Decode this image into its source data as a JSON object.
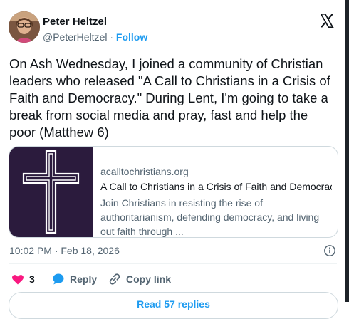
{
  "author": {
    "name": "Peter Heltzel",
    "handle": "@PeterHeltzel",
    "separator": "·",
    "follow_label": "Follow"
  },
  "tweet": {
    "text": "On Ash Wednesday, I joined a community of Christian leaders who released \"A Call to Christians in a Crisis of Faith and Democracy.\" During Lent, I'm going to take a break from social media and pray, fast and help the poor (Matthew 6)"
  },
  "card": {
    "domain": "acalltochristians.org",
    "title": "A Call to Christians in a Crisis of Faith and Democrac...",
    "description": "Join Christians in resisting the rise of authoritarianism, defending democracy, and living out faith through ..."
  },
  "timestamp": "10:02 PM · Feb 18, 2026",
  "actions": {
    "like_count": "3",
    "reply_label": "Reply",
    "copy_label": "Copy link"
  },
  "read_more_label": "Read 57 replies",
  "colors": {
    "accent": "#1d9bf0",
    "like": "#f91880",
    "muted": "#536471",
    "card_image_bg": "#2b1b3d"
  },
  "icons": [
    "x-logo-icon",
    "info-icon",
    "heart-icon",
    "reply-bubble-icon",
    "link-icon",
    "cross-icon"
  ]
}
